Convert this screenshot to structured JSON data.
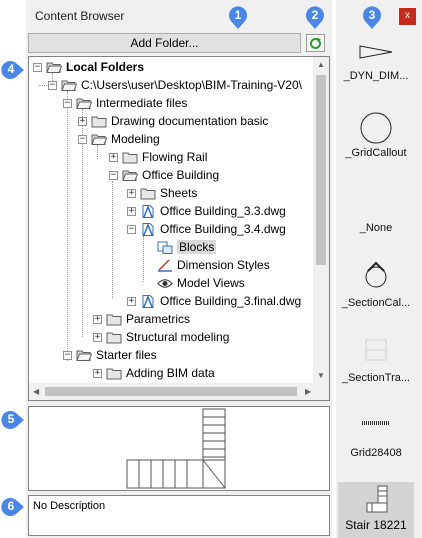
{
  "panel": {
    "title": "Content Browser",
    "add_folder_label": "Add Folder...",
    "refresh_icon": "refresh-icon"
  },
  "tree": {
    "nodes": [
      {
        "label": "Local Folders",
        "expander": "−"
      },
      {
        "label": "C:\\Users\\user\\Desktop\\BIM-Training-V20\\",
        "expander": "−"
      },
      {
        "label": "Intermediate files",
        "expander": "−"
      },
      {
        "label": "Drawing documentation basic",
        "expander": "+"
      },
      {
        "label": "Modeling",
        "expander": "−"
      },
      {
        "label": "Flowing Rail",
        "expander": "+"
      },
      {
        "label": "Office Building",
        "expander": "−"
      },
      {
        "label": "Sheets",
        "expander": "+"
      },
      {
        "label": "Office Building_3.3.dwg",
        "expander": "+"
      },
      {
        "label": "Office Building_3.4.dwg",
        "expander": "−"
      },
      {
        "label": "Blocks",
        "expander": ""
      },
      {
        "label": "Dimension Styles",
        "expander": ""
      },
      {
        "label": "Model Views",
        "expander": ""
      },
      {
        "label": "Office Building_3.final.dwg",
        "expander": "+"
      },
      {
        "label": "Parametrics",
        "expander": "+"
      },
      {
        "label": "Structural modeling",
        "expander": "+"
      },
      {
        "label": "Starter files",
        "expander": "−"
      },
      {
        "label": "Adding BIM data",
        "expander": "+"
      }
    ]
  },
  "description": {
    "text": "No Description"
  },
  "right_panel": {
    "close_label": "x",
    "tiles": [
      {
        "label": "_DYN_DIM..."
      },
      {
        "label": "_GridCallout"
      },
      {
        "label": "_None"
      },
      {
        "label": "_SectionCal..."
      },
      {
        "label": "_SectionTra..."
      },
      {
        "label": "Grid28408"
      },
      {
        "label": "Stair 18221"
      }
    ]
  },
  "callouts": [
    "1",
    "2",
    "3",
    "4",
    "5",
    "6"
  ],
  "colors": {
    "callout": "#4a86e8",
    "close": "#c42b1c",
    "selection": "#d9d9d9"
  }
}
